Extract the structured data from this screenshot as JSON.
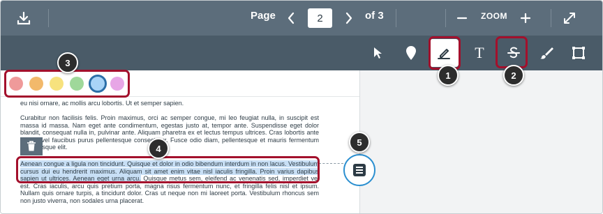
{
  "topbar": {
    "page_label": "Page",
    "page_value": "2",
    "page_total": "of 3",
    "zoom_label": "ZOOM"
  },
  "icons": {
    "download": "download-icon",
    "prev": "chevron-left-icon",
    "next": "chevron-right-icon",
    "zoom_out": "minus-icon",
    "zoom_in": "plus-icon",
    "fullscreen": "expand-icon",
    "select": "pointer-icon",
    "point": "pin-icon",
    "highlight": "highlight-pen-icon",
    "text": "text-icon",
    "strike": "strikeout-icon",
    "draw": "brush-icon",
    "area": "area-icon",
    "delete": "trash-icon",
    "comment": "comment-icon"
  },
  "tools": {
    "text_glyph": "T"
  },
  "colors": [
    "#ef9a9a",
    "#f2b96b",
    "#f7e27e",
    "#9fd89a",
    "#a8d4f7",
    "#e7a6e6"
  ],
  "accent": "#a3102c",
  "callouts": [
    "1",
    "2",
    "3",
    "4",
    "5"
  ],
  "document": {
    "p0": "eu nisi ornare, ac mollis arcu lobortis. Ut et semper sapien.",
    "p1": "Curabitur non facilisis felis. Proin maximus, orci ac semper congue, mi leo feugiat nulla, in suscipit est massa id massa. Nam eget ante condimentum, egestas justo at, tempor ante. Suspendisse eget dolor blandit, consequat nulla in, pulvinar ante. Aliquam pharetra ex et lectus tempus ultrices. Cras lobortis ante metus, vel faucibus purus pellentesque consectetur. Fusce odio diam, pellentesque et mauris fermentum pellentesque elit.",
    "p2_selected": "Aenean congue a ligula non tincidunt. Quisque et dolor in odio bibendum interdum in non lacus. Vestibulum cursus dui eu hendrerit maximus. Aliquam sit amet enim vitae nisl iaculis fringilla. Proin varius dapibus sapien ut ultrices. Aenean eget urna arcu.",
    "p2_rest": " Quisque metus sem, eleifend ac venenatis sed, imperdiet vel est. Cras iaculis, arcu quis pretium porta, magna risus fermentum nunc, et fringilla felis nisl et ipsum. Nullam quis ornare turpis, a tincidunt dolor. Cras ut neque non mi laoreet porta. Vestibulum rhoncus sem non justo viverra, non sodales urna placerat."
  }
}
